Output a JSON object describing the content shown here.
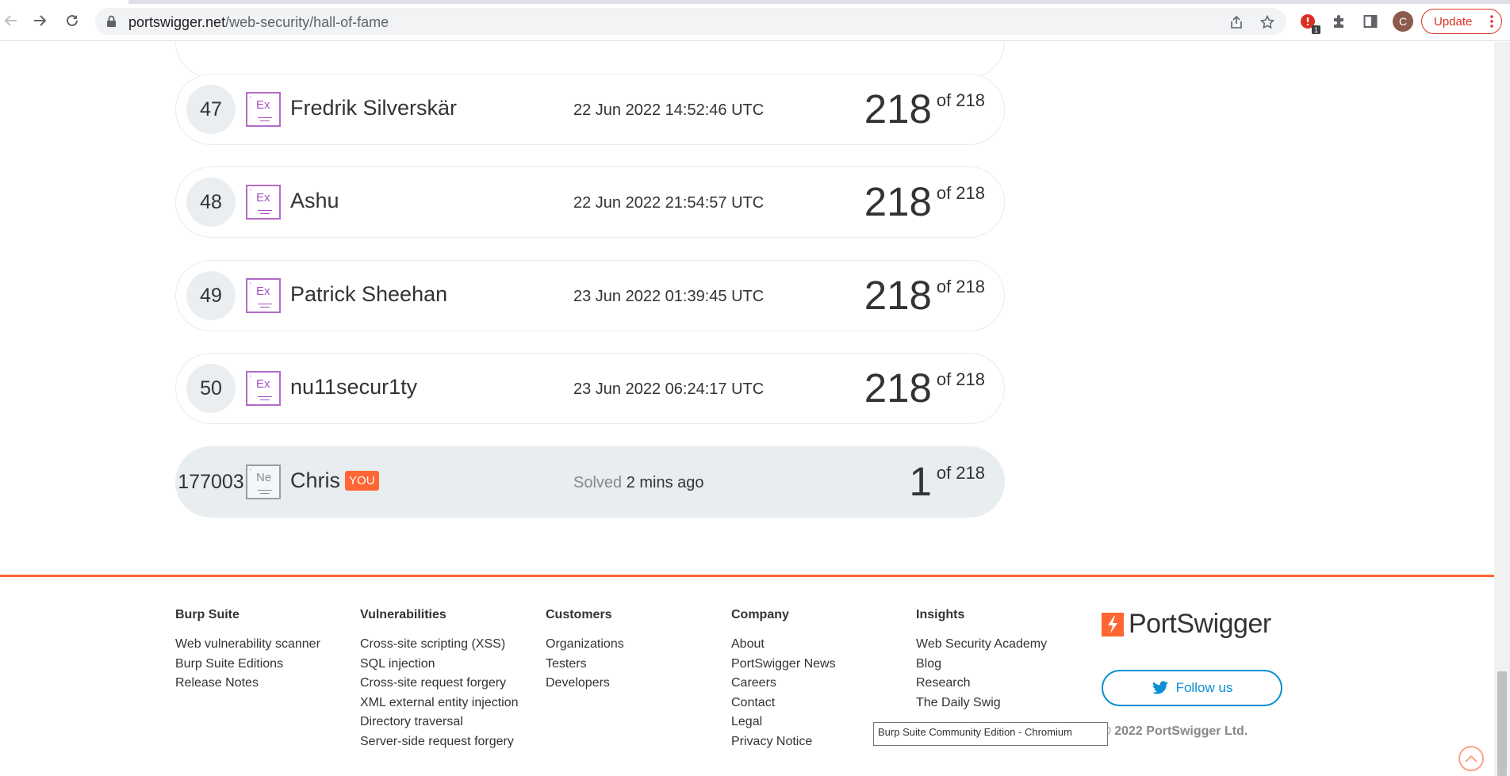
{
  "browser": {
    "url_domain": "portswigger.net",
    "url_path": "/web-security/hall-of-fame",
    "avatar_letter": "C",
    "update_label": "Update",
    "extension_badge": "1"
  },
  "leaderboard": {
    "rows": [
      {
        "rank": "47",
        "badge": "Ex",
        "name": "Fredrik Silverskär",
        "date": "22 Jun 2022 14:52:46 UTC",
        "score": "218",
        "of": "of 218"
      },
      {
        "rank": "48",
        "badge": "Ex",
        "name": "Ashu",
        "date": "22 Jun 2022 21:54:57 UTC",
        "score": "218",
        "of": "of 218"
      },
      {
        "rank": "49",
        "badge": "Ex",
        "name": "Patrick Sheehan",
        "date": "23 Jun 2022 01:39:45 UTC",
        "score": "218",
        "of": "of 218"
      },
      {
        "rank": "50",
        "badge": "Ex",
        "name": "nu11secur1ty",
        "date": "23 Jun 2022 06:24:17 UTC",
        "score": "218",
        "of": "of 218"
      }
    ],
    "you": {
      "rank": "177003",
      "badge": "Ne",
      "name": "Chris",
      "tag": "YOU",
      "solved_label": "Solved",
      "solved_time": "2 mins ago",
      "score": "1",
      "of": "of 218"
    }
  },
  "footer": {
    "columns": [
      {
        "heading": "Burp Suite",
        "links": [
          "Web vulnerability scanner",
          "Burp Suite Editions",
          "Release Notes"
        ]
      },
      {
        "heading": "Vulnerabilities",
        "links": [
          "Cross-site scripting (XSS)",
          "SQL injection",
          "Cross-site request forgery",
          "XML external entity injection",
          "Directory traversal",
          "Server-side request forgery"
        ]
      },
      {
        "heading": "Customers",
        "links": [
          "Organizations",
          "Testers",
          "Developers"
        ]
      },
      {
        "heading": "Company",
        "links": [
          "About",
          "PortSwigger News",
          "Careers",
          "Contact",
          "Legal",
          "Privacy Notice"
        ]
      },
      {
        "heading": "Insights",
        "links": [
          "Web Security Academy",
          "Blog",
          "Research",
          "The Daily Swig"
        ]
      }
    ],
    "logo_text": "PortSwigger",
    "follow_label": "Follow us",
    "copyright": "© 2022 PortSwigger Ltd.",
    "tooltip": "Burp Suite Community Edition - Chromium"
  },
  "colors": {
    "accent": "#ff6633",
    "twitter": "#0a90d3",
    "expert_badge": "#b36bc7"
  }
}
